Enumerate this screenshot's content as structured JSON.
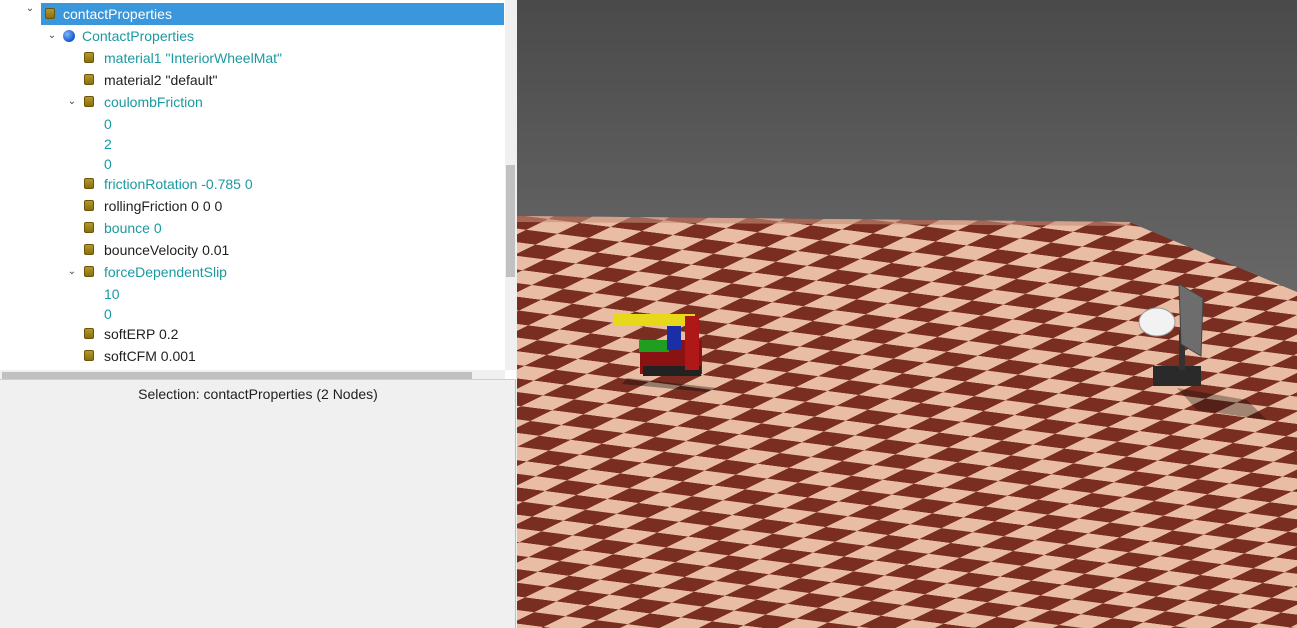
{
  "scene_tree": {
    "nodes": [
      {
        "label": "contactProperties",
        "selected": true
      },
      {
        "label": "ContactProperties"
      },
      {
        "label": "material1 \"InteriorWheelMat\""
      },
      {
        "label": "material2 \"default\""
      },
      {
        "label": "coulombFriction"
      },
      {
        "label": "0"
      },
      {
        "label": "2"
      },
      {
        "label": "0"
      },
      {
        "label": "frictionRotation -0.785 0"
      },
      {
        "label": "rollingFriction 0 0 0"
      },
      {
        "label": "bounce 0"
      },
      {
        "label": "bounceVelocity 0.01"
      },
      {
        "label": "forceDependentSlip"
      },
      {
        "label": "10"
      },
      {
        "label": "0"
      },
      {
        "label": "softERP 0.2"
      },
      {
        "label": "softCFM 0.001"
      }
    ]
  },
  "selection_status": "Selection: contactProperties (2 Nodes)",
  "colors": {
    "selected_row": "#3a97db",
    "modified_field": "#1a9aa0",
    "floor_dark": "#7a2e22",
    "floor_light": "#e9bda4",
    "sky_top": "#4a4a4a",
    "sky_bottom": "#8a8a8a"
  }
}
